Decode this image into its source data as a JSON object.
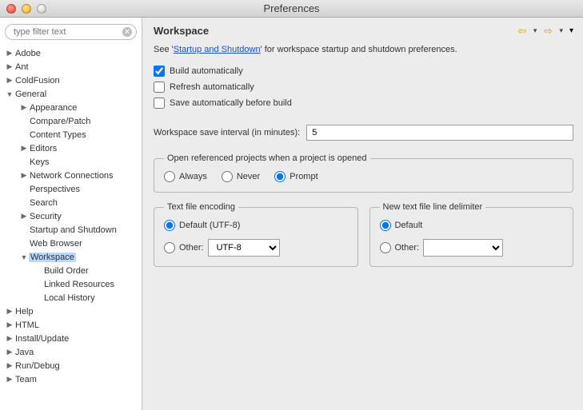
{
  "window": {
    "title": "Preferences"
  },
  "sidebar": {
    "filter_placeholder": "type filter text",
    "items": {
      "adobe": {
        "label": "Adobe"
      },
      "ant": {
        "label": "Ant"
      },
      "coldfusion": {
        "label": "ColdFusion"
      },
      "general": {
        "label": "General"
      },
      "appearance": {
        "label": "Appearance"
      },
      "compare_patch": {
        "label": "Compare/Patch"
      },
      "content_types": {
        "label": "Content Types"
      },
      "editors": {
        "label": "Editors"
      },
      "keys": {
        "label": "Keys"
      },
      "network_connections": {
        "label": "Network Connections"
      },
      "perspectives": {
        "label": "Perspectives"
      },
      "search": {
        "label": "Search"
      },
      "security": {
        "label": "Security"
      },
      "startup_shutdown": {
        "label": "Startup and Shutdown"
      },
      "web_browser": {
        "label": "Web Browser"
      },
      "workspace": {
        "label": "Workspace"
      },
      "build_order": {
        "label": "Build Order"
      },
      "linked_resources": {
        "label": "Linked Resources"
      },
      "local_history": {
        "label": "Local History"
      },
      "help": {
        "label": "Help"
      },
      "html": {
        "label": "HTML"
      },
      "install_update": {
        "label": "Install/Update"
      },
      "java": {
        "label": "Java"
      },
      "run_debug": {
        "label": "Run/Debug"
      },
      "team": {
        "label": "Team"
      }
    }
  },
  "main": {
    "title": "Workspace",
    "desc_prefix": "See '",
    "desc_link": "Startup and Shutdown",
    "desc_suffix": "' for workspace startup and shutdown preferences.",
    "checks": {
      "build_auto": {
        "label": "Build automatically",
        "checked": true
      },
      "refresh_auto": {
        "label": "Refresh automatically",
        "checked": false
      },
      "save_before": {
        "label": "Save automatically before build",
        "checked": false
      }
    },
    "interval": {
      "label": "Workspace save interval (in minutes):",
      "value": "5"
    },
    "open_ref": {
      "legend": "Open referenced projects when a project is opened",
      "always": "Always",
      "never": "Never",
      "prompt": "Prompt",
      "selected": "prompt"
    },
    "encoding": {
      "legend": "Text file encoding",
      "default_label": "Default (UTF-8)",
      "other_label": "Other:",
      "other_value": "UTF-8",
      "selected": "default"
    },
    "delimiter": {
      "legend": "New text file line delimiter",
      "default_label": "Default",
      "other_label": "Other:",
      "selected": "default"
    }
  }
}
